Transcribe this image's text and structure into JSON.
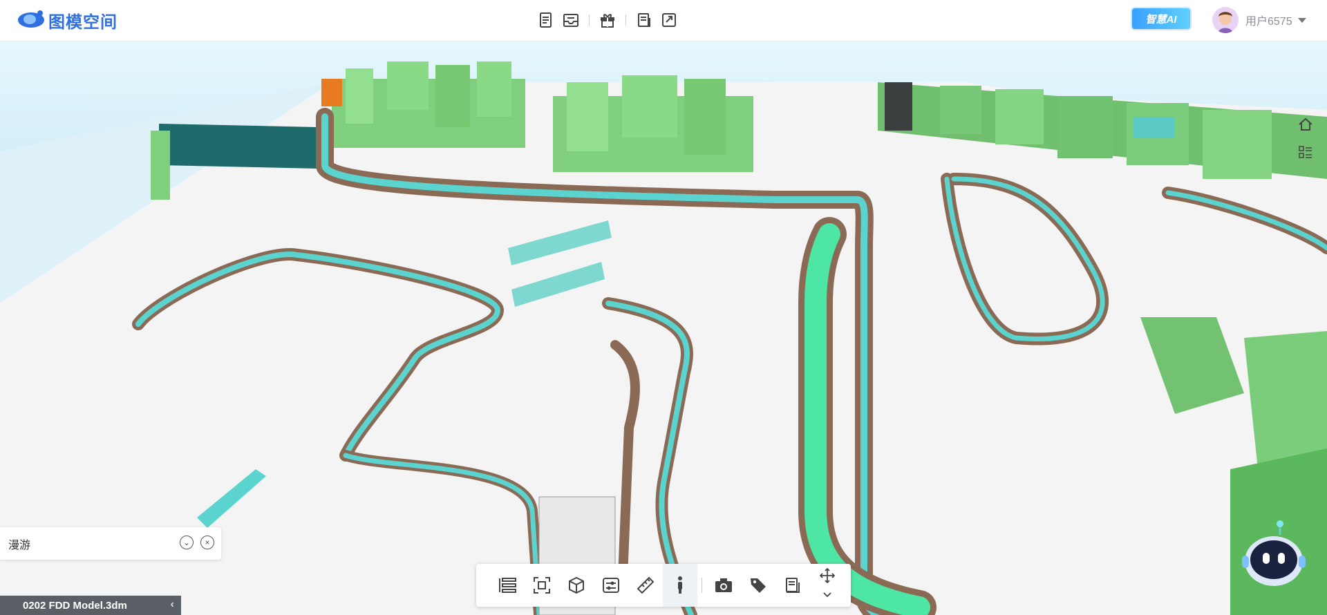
{
  "app": {
    "name": "图模空间"
  },
  "header": {
    "toolbar": [
      "document-icon",
      "inbox-icon",
      "gift-icon",
      "layers-doc-icon",
      "expand-icon"
    ],
    "ai_badge": "智慧AI",
    "user": {
      "name": "用户6575"
    }
  },
  "viewport": {
    "side_icons": [
      "home-icon",
      "list-view-icon"
    ]
  },
  "roam_panel": {
    "label": "漫游"
  },
  "model": {
    "name": "0202 FDD Model.3dm"
  },
  "bottom_toolbar": [
    "tree-icon",
    "focus-icon",
    "cube-icon",
    "sliders-icon",
    "ruler-icon",
    "person-walk-icon",
    "camera-icon",
    "tag-icon",
    "layers-doc-icon",
    "move-icon"
  ],
  "colors": {
    "brand": "#2f6fe0",
    "accent_green": "#4ee6a4",
    "accent_teal": "#5bd4d0",
    "wall_brown": "#8a6a55"
  }
}
